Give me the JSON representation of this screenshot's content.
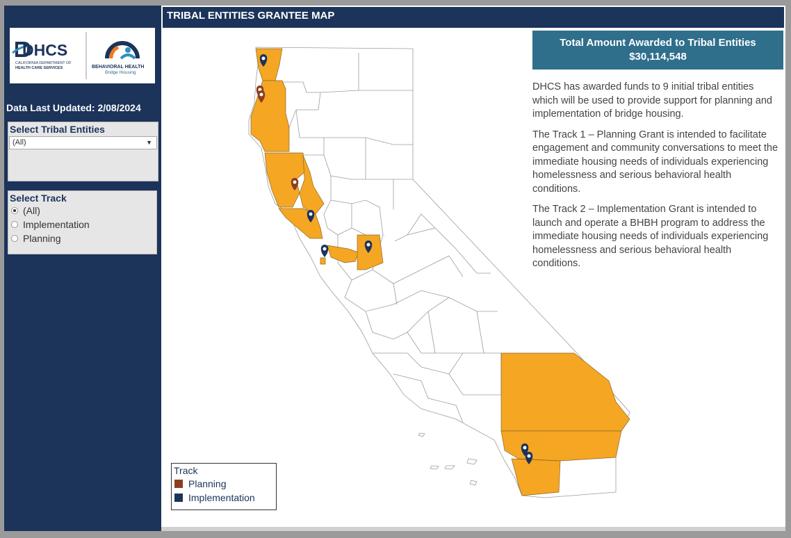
{
  "header": {
    "title": "TRIBAL ENTITIES GRANTEE MAP"
  },
  "logos": {
    "dhcs_wordmark": "DHCS",
    "dhcs_subtitle_line1": "CALIFORNIA DEPARTMENT OF",
    "dhcs_subtitle_line2": "HEALTH CARE SERVICES",
    "bh_line1": "BEHAVIORAL HEALTH",
    "bh_line2": "Bridge Housing"
  },
  "sidebar": {
    "updated": "Data Last Updated: 2/08/2024",
    "entities_filter": {
      "title": "Select Tribal Entities",
      "value": "(All)"
    },
    "track_filter": {
      "title": "Select Track",
      "options": [
        {
          "label": "(All)",
          "selected": true
        },
        {
          "label": "Implementation",
          "selected": false
        },
        {
          "label": "Planning",
          "selected": false
        }
      ]
    }
  },
  "summary": {
    "title": "Total Amount Awarded to Tribal Entities",
    "amount": "$30,114,548"
  },
  "description": [
    "DHCS has awarded funds to 9 initial tribal entities which will be used to provide support for planning and implementation of bridge housing.",
    "The Track 1 – Planning Grant is intended to facilitate engagement and community conversations to meet the immediate housing needs of individuals experiencing homelessness and serious behavioral health conditions.",
    "The Track 2 – Implementation Grant is intended to launch and operate a BHBH program to address the immediate housing needs of individuals experiencing homelessness and serious behavioral health conditions."
  ],
  "legend": {
    "title": "Track",
    "items": [
      {
        "label": "Planning",
        "color": "#8b3f1e"
      },
      {
        "label": "Implementation",
        "color": "#1c335a"
      }
    ]
  },
  "colors": {
    "navy": "#1c335a",
    "teal": "#2f6f8c",
    "county_fill": "#f5a623",
    "planning": "#8b3f1e",
    "implementation": "#1c335a"
  },
  "map": {
    "pins": [
      {
        "track": "Implementation",
        "county": "Del Norte"
      },
      {
        "track": "Planning",
        "county": "Humboldt"
      },
      {
        "track": "Planning",
        "county": "Humboldt"
      },
      {
        "track": "Planning",
        "county": "Mendocino"
      },
      {
        "track": "Implementation",
        "county": "Sonoma"
      },
      {
        "track": "Implementation",
        "county": "San Francisco"
      },
      {
        "track": "Implementation",
        "county": "Stanislaus"
      },
      {
        "track": "Implementation",
        "county": "Riverside"
      },
      {
        "track": "Implementation",
        "county": "Riverside"
      }
    ]
  }
}
